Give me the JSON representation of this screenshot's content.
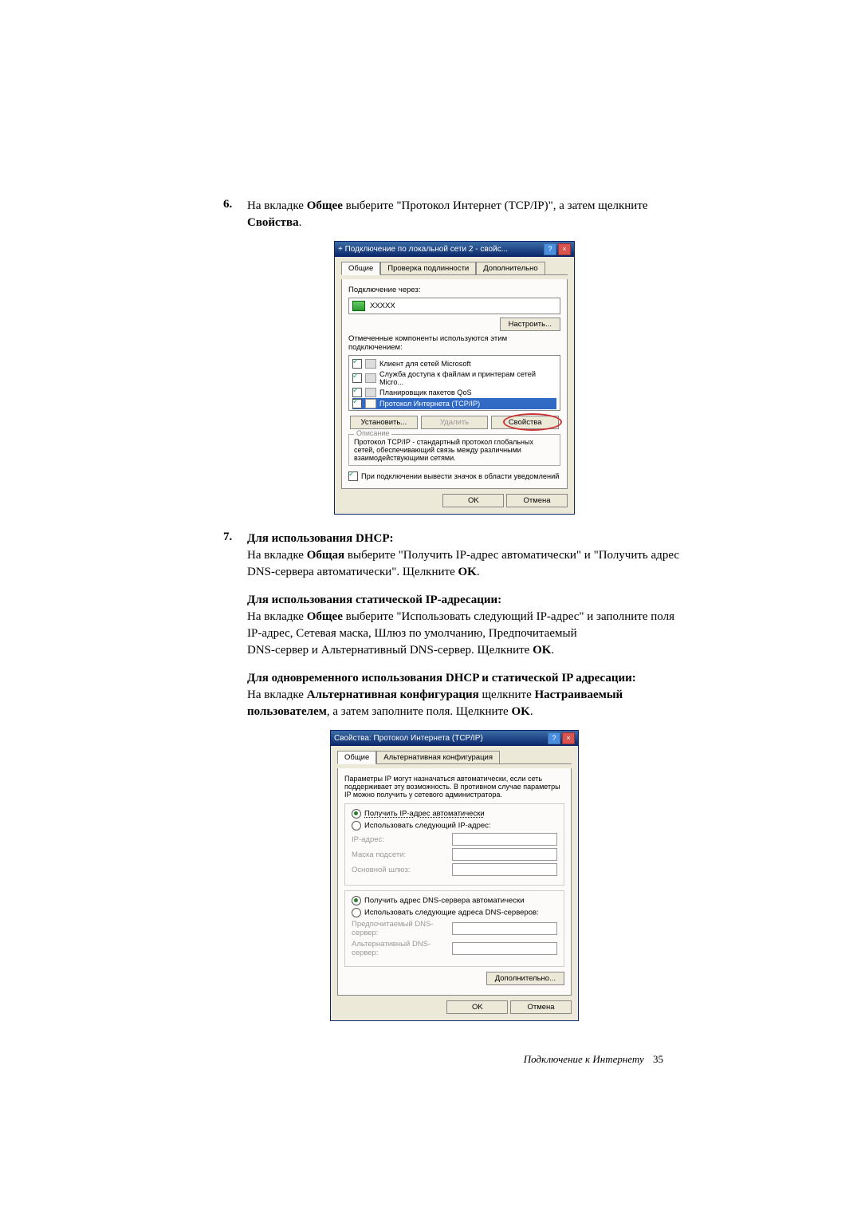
{
  "step6": {
    "num": "6.",
    "text_a": "На вкладке ",
    "bold_a": "Общее",
    "text_b": " выберите \"Протокол Интернет (TCP/IP)\", а затем щелкните ",
    "bold_b": "Свойства",
    "text_c": "."
  },
  "dlg1": {
    "title": "+ Подключение по локальной сети 2 - свойс...",
    "tabs": {
      "t1": "Общие",
      "t2": "Проверка подлинности",
      "t3": "Дополнительно"
    },
    "connect_label": "Подключение через:",
    "adapter": "XXXXX",
    "configure": "Настроить...",
    "components_label": "Отмеченные компоненты используются этим подключением:",
    "items": {
      "i1": "Клиент для сетей Microsoft",
      "i2": "Служба доступа к файлам и принтерам сетей Micro...",
      "i3": "Планировщик пакетов QoS",
      "i4": "Протокол Интернета (TCP/IP)"
    },
    "install": "Установить...",
    "remove": "Удалить",
    "props": "Свойства",
    "desc_legend": "Описание",
    "desc_text": "Протокол TCP/IP - стандартный протокол глобальных сетей, обеспечивающий связь между различными взаимодействующими сетями.",
    "notify": "При подключении вывести значок в области уведомлений",
    "ok": "OK",
    "cancel": "Отмена"
  },
  "step7": {
    "num": "7.",
    "heading": "Для использования DHCP:",
    "p1a": "На вкладке ",
    "p1b": "Общая",
    "p1c": " выберите \"Получить IP-адрес автоматически\" и \"Получить адрес DNS-сервера автоматически\". Щелкните ",
    "p1d": "OK",
    "p1e": ".",
    "heading2": "Для использования статической IP-адресации:",
    "p2a": "На вкладке ",
    "p2b": "Общее",
    "p2c": " выберите \"Использовать следующий IP-адрес\" и заполните поля IP-адрес, Сетевая маска, Шлюз по умолчанию, Предпочитаемый",
    "p2d": "DNS-сервер и Альтернативный DNS-сервер. Щелкните ",
    "p2e": "OK",
    "p2f": ".",
    "heading3": "Для одновременного использования DHCP и статической IP адресации:",
    "p3a": "На вкладке ",
    "p3b": "Альтернативная конфигурация",
    "p3c": " щелкните ",
    "p3d": "Настраиваемый пользователем",
    "p3e": ", а затем заполните поля. Щелкните ",
    "p3f": "OK",
    "p3g": "."
  },
  "dlg2": {
    "title": "Свойства: Протокол Интернета (TCP/IP)",
    "tabs": {
      "t1": "Общие",
      "t2": "Альтернативная конфигурация"
    },
    "intro": "Параметры IP могут назначаться автоматически, если сеть поддерживает эту возможность. В противном случае параметры IP можно получить у сетевого администратора.",
    "r1": "Получить IP-адрес автоматически",
    "r2": "Использовать следующий IP-адрес:",
    "ip": "IP-адрес:",
    "mask": "Маска подсети:",
    "gw": "Основной шлюз:",
    "r3": "Получить адрес DNS-сервера автоматически",
    "r4": "Использовать следующие адреса DNS-серверов:",
    "dns1": "Предпочитаемый DNS-сервер:",
    "dns2": "Альтернативный DNS-сервер:",
    "advanced": "Дополнительно...",
    "ok": "OK",
    "cancel": "Отмена"
  },
  "footer": {
    "text": "Подключение к Интернету",
    "page": "35"
  }
}
